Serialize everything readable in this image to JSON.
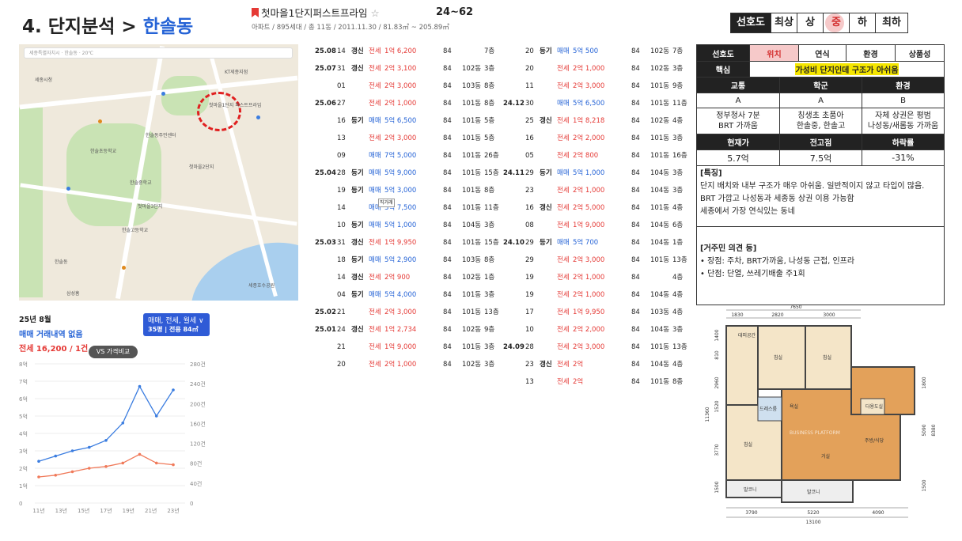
{
  "header": {
    "section_num": "4. 단지분석 > ",
    "section_area": "한솔동"
  },
  "complex": {
    "name": "첫마을1단지퍼스트프라임",
    "star": "☆",
    "sub": "아파트 / 895세대 / 총 11동 / 2011.11.30 / 81.83㎡ ~ 205.89㎡",
    "range": "24~62"
  },
  "preference": {
    "label": "선호도",
    "options": [
      "최상",
      "상",
      "중",
      "하",
      "최하"
    ],
    "selected": "중"
  },
  "map": {
    "search_placeholder": "세종특별자치시 · 한솔동 · 20℃",
    "labels": [
      "첫마을1단지 퍼스트프라임",
      "한솔초등학교",
      "세종시청",
      "KT세종지점",
      "한솔동주민센터",
      "한솔중학교",
      "한솔고등학교",
      "한솔동",
      "삼성홈",
      "첫마을2단지",
      "첫마을3단지",
      "세종호수공원"
    ]
  },
  "chart": {
    "month": "25년 8월",
    "trade": "매매 거래내역 없음",
    "lease": "전세 16,200 / 1건",
    "type_label": "매매, 전세, 월세 ∨",
    "type_sub": "35평 | 전용 84㎡",
    "vs_label": "VS 가격비교"
  },
  "chart_data": {
    "type": "line",
    "x": [
      "11년",
      "13년",
      "15년",
      "17년",
      "19년",
      "21년",
      "23년"
    ],
    "y_left_ticks": [
      "8억",
      "7억",
      "6억",
      "5억",
      "4억",
      "3억",
      "2억",
      "1억",
      "0"
    ],
    "y_right_ticks": [
      "280건",
      "240건",
      "200건",
      "160건",
      "120건",
      "80건",
      "40건",
      "0"
    ],
    "series": [
      {
        "name": "매매",
        "color": "#3b7de0",
        "values": [
          2.4,
          2.7,
          3.0,
          3.2,
          3.6,
          4.6,
          6.7,
          5.0,
          6.5
        ]
      },
      {
        "name": "전세",
        "color": "#f07a5a",
        "values": [
          1.5,
          1.6,
          1.8,
          2.0,
          2.1,
          2.3,
          2.8,
          2.3,
          2.2
        ]
      }
    ]
  },
  "transactions_left": [
    {
      "date": "25.08",
      "day": "14",
      "tag": "갱신",
      "type": "전세",
      "price": "1억 6,200",
      "area": "84",
      "dong": "",
      "floor": "7층"
    },
    {
      "date": "25.07",
      "day": "31",
      "tag": "갱신",
      "type": "전세",
      "price": "2억 3,100",
      "area": "84",
      "dong": "102동",
      "floor": "3층"
    },
    {
      "date": "",
      "day": "01",
      "tag": "",
      "type": "전세",
      "price": "2억 3,000",
      "area": "84",
      "dong": "103동",
      "floor": "8층"
    },
    {
      "date": "25.06",
      "day": "27",
      "tag": "",
      "type": "전세",
      "price": "2억 1,000",
      "area": "84",
      "dong": "101동",
      "floor": "8층"
    },
    {
      "date": "",
      "day": "16",
      "tag": "등기",
      "type": "매매",
      "price": "5억 6,500",
      "area": "84",
      "dong": "101동",
      "floor": "5층"
    },
    {
      "date": "",
      "day": "13",
      "tag": "",
      "type": "전세",
      "price": "2억 3,000",
      "area": "84",
      "dong": "101동",
      "floor": "5층"
    },
    {
      "date": "",
      "day": "09",
      "tag": "",
      "type": "매매",
      "price": "7억 5,000",
      "area": "84",
      "dong": "101동",
      "floor": "26층"
    },
    {
      "date": "25.04",
      "day": "28",
      "tag": "등기",
      "type": "매매",
      "price": "5억 9,000",
      "area": "84",
      "dong": "101동",
      "floor": "15층"
    },
    {
      "date": "",
      "day": "19",
      "tag": "등기",
      "type": "매매",
      "price": "5억 3,000",
      "area": "84",
      "dong": "101동",
      "floor": "8층"
    },
    {
      "date": "",
      "day": "14",
      "tag": "",
      "type": "매매",
      "price": "3억 7,500",
      "area": "84",
      "dong": "101동",
      "floor": "11층",
      "note": "직거래"
    },
    {
      "date": "",
      "day": "10",
      "tag": "등기",
      "type": "매매",
      "price": "5억 1,000",
      "area": "84",
      "dong": "104동",
      "floor": "3층"
    },
    {
      "date": "25.03",
      "day": "31",
      "tag": "갱신",
      "type": "전세",
      "price": "1억 9,950",
      "area": "84",
      "dong": "101동",
      "floor": "15층"
    },
    {
      "date": "",
      "day": "18",
      "tag": "등기",
      "type": "매매",
      "price": "5억 2,900",
      "area": "84",
      "dong": "103동",
      "floor": "8층"
    },
    {
      "date": "",
      "day": "14",
      "tag": "갱신",
      "type": "전세",
      "price": "2억 900",
      "area": "84",
      "dong": "102동",
      "floor": "1층"
    },
    {
      "date": "",
      "day": "04",
      "tag": "등기",
      "type": "매매",
      "price": "5억 4,000",
      "area": "84",
      "dong": "101동",
      "floor": "3층"
    },
    {
      "date": "25.02",
      "day": "21",
      "tag": "",
      "type": "전세",
      "price": "2억 3,000",
      "area": "84",
      "dong": "101동",
      "floor": "13층"
    },
    {
      "date": "25.01",
      "day": "24",
      "tag": "갱신",
      "type": "전세",
      "price": "1억 2,734",
      "area": "84",
      "dong": "102동",
      "floor": "9층"
    },
    {
      "date": "",
      "day": "21",
      "tag": "",
      "type": "전세",
      "price": "1억 9,000",
      "area": "84",
      "dong": "101동",
      "floor": "3층"
    },
    {
      "date": "",
      "day": "20",
      "tag": "",
      "type": "전세",
      "price": "2억 1,000",
      "area": "84",
      "dong": "102동",
      "floor": "3층"
    }
  ],
  "transactions_right": [
    {
      "date": "",
      "day": "20",
      "tag": "등기",
      "type": "매매",
      "price": "5억 500",
      "area": "84",
      "dong": "102동",
      "floor": "7층"
    },
    {
      "date": "",
      "day": "20",
      "tag": "",
      "type": "전세",
      "price": "2억 1,000",
      "area": "84",
      "dong": "102동",
      "floor": "3층"
    },
    {
      "date": "",
      "day": "11",
      "tag": "",
      "type": "전세",
      "price": "2억 3,000",
      "area": "84",
      "dong": "101동",
      "floor": "9층"
    },
    {
      "date": "24.12",
      "day": "30",
      "tag": "",
      "type": "매매",
      "price": "5억 6,500",
      "area": "84",
      "dong": "101동",
      "floor": "11층"
    },
    {
      "date": "",
      "day": "25",
      "tag": "갱신",
      "type": "전세",
      "price": "1억 8,218",
      "area": "84",
      "dong": "102동",
      "floor": "4층"
    },
    {
      "date": "",
      "day": "16",
      "tag": "",
      "type": "전세",
      "price": "2억 2,000",
      "area": "84",
      "dong": "101동",
      "floor": "3층"
    },
    {
      "date": "",
      "day": "05",
      "tag": "",
      "type": "전세",
      "price": "2억 800",
      "area": "84",
      "dong": "101동",
      "floor": "16층"
    },
    {
      "date": "24.11",
      "day": "29",
      "tag": "등기",
      "type": "매매",
      "price": "5억 1,000",
      "area": "84",
      "dong": "104동",
      "floor": "3층"
    },
    {
      "date": "",
      "day": "23",
      "tag": "",
      "type": "전세",
      "price": "2억 1,000",
      "area": "84",
      "dong": "104동",
      "floor": "3층"
    },
    {
      "date": "",
      "day": "16",
      "tag": "갱신",
      "type": "전세",
      "price": "2억 5,000",
      "area": "84",
      "dong": "101동",
      "floor": "4층"
    },
    {
      "date": "",
      "day": "08",
      "tag": "",
      "type": "전세",
      "price": "1억 9,000",
      "area": "84",
      "dong": "104동",
      "floor": "6층"
    },
    {
      "date": "24.10",
      "day": "29",
      "tag": "등기",
      "type": "매매",
      "price": "5억 700",
      "area": "84",
      "dong": "104동",
      "floor": "1층"
    },
    {
      "date": "",
      "day": "29",
      "tag": "",
      "type": "전세",
      "price": "2억 3,000",
      "area": "84",
      "dong": "101동",
      "floor": "13층"
    },
    {
      "date": "",
      "day": "19",
      "tag": "",
      "type": "전세",
      "price": "2억 1,000",
      "area": "84",
      "dong": "",
      "floor": "4층"
    },
    {
      "date": "",
      "day": "19",
      "tag": "",
      "type": "전세",
      "price": "2억 1,000",
      "area": "84",
      "dong": "104동",
      "floor": "4층"
    },
    {
      "date": "",
      "day": "17",
      "tag": "",
      "type": "전세",
      "price": "1억 9,950",
      "area": "84",
      "dong": "103동",
      "floor": "4층"
    },
    {
      "date": "",
      "day": "10",
      "tag": "",
      "type": "전세",
      "price": "2억 2,000",
      "area": "84",
      "dong": "104동",
      "floor": "3층"
    },
    {
      "date": "24.09",
      "day": "28",
      "tag": "",
      "type": "전세",
      "price": "2억 3,000",
      "area": "84",
      "dong": "101동",
      "floor": "13층"
    },
    {
      "date": "",
      "day": "23",
      "tag": "갱신",
      "type": "전세",
      "price": "2억",
      "area": "84",
      "dong": "104동",
      "floor": "4층"
    },
    {
      "date": "",
      "day": "13",
      "tag": "",
      "type": "전세",
      "price": "2억",
      "area": "84",
      "dong": "101동",
      "floor": "8층"
    }
  ],
  "info": {
    "head": [
      "선호도",
      "위치",
      "연식",
      "환경",
      "상품성"
    ],
    "core_label": "핵심",
    "core_value": "가성비 단지인데 구조가 아쉬움",
    "grade_head": [
      "교통",
      "학군",
      "환경"
    ],
    "grades": [
      "A",
      "A",
      "B"
    ],
    "descs": [
      "정부청사 7분\nBRT 가까움",
      "칭생초 초품아\n한솔중, 한솔고",
      "자체 상권은 평범\n나성동/새롬동 가까움"
    ],
    "price_head": [
      "현재가",
      "전고점",
      "하락률"
    ],
    "prices": [
      "5.7억",
      "7.5억",
      "-31%"
    ],
    "feature_title": "[특징]",
    "feature_text": "단지 배치와 내부 구조가 매우 아쉬움. 일반적이지 않고 타입이 많음. BRT 가깝고 나성동과 세종동 상권 이용 가능함\n세종에서 가장 연식있는 동네",
    "opinion_title": "[거주민 의견 등]",
    "pros": "• 장점: 주차, BRT가까움, 나성동 근접, 인프라",
    "cons": "• 단점: 단열, 쓰레기배출 주1회"
  },
  "floorplan": {
    "dims_top": [
      "7650",
      "1830",
      "2820",
      "3000"
    ],
    "dims_bottom": [
      "3790",
      "5220",
      "4090",
      "13100"
    ],
    "dims_left": [
      "1400",
      "810",
      "2960",
      "1520",
      "3770",
      "1500",
      "11360"
    ],
    "dims_right": [
      "1800",
      "5090",
      "1500",
      "8380"
    ],
    "rooms": [
      "대피공간",
      "침실",
      "침실",
      "드레스룸",
      "다용도실",
      "침실",
      "거실",
      "주방/식당",
      "발코니",
      "발코니",
      "BUSINESS PLATFORM",
      "욕실"
    ]
  }
}
